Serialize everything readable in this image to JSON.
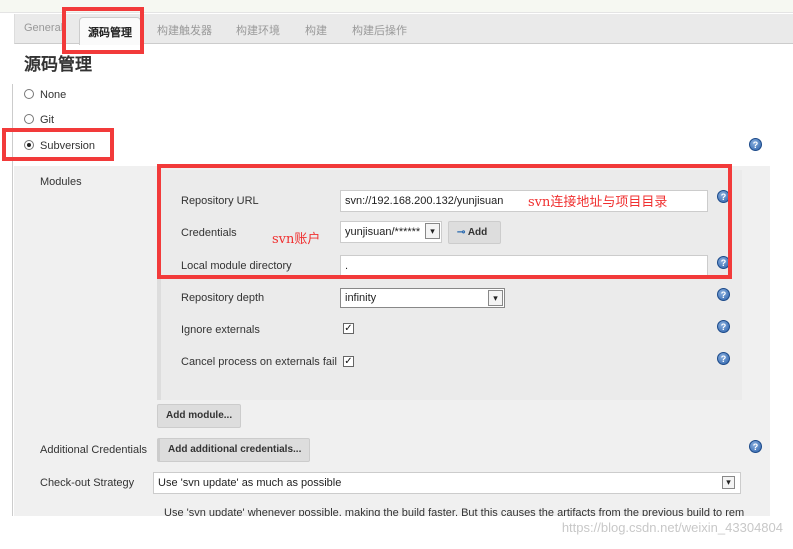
{
  "tabs": [
    {
      "label": "General"
    },
    {
      "label": "源码管理"
    },
    {
      "label": "构建触发器"
    },
    {
      "label": "构建环境"
    },
    {
      "label": "构建"
    },
    {
      "label": "构建后操作"
    }
  ],
  "section_title": "源码管理",
  "scm_options": [
    {
      "label": "None",
      "selected": false
    },
    {
      "label": "Git",
      "selected": false
    },
    {
      "label": "Subversion",
      "selected": true
    }
  ],
  "modules_label": "Modules",
  "repo_url": {
    "label": "Repository URL",
    "value": "svn://192.168.200.132/yunjisuan"
  },
  "credentials": {
    "label": "Credentials",
    "value": "yunjisuan/******",
    "add_label": "Add"
  },
  "local_dir": {
    "label": "Local module directory",
    "value": "."
  },
  "repo_depth": {
    "label": "Repository depth",
    "value": "infinity"
  },
  "ignore_externals": {
    "label": "Ignore externals",
    "checked": true
  },
  "cancel_externals": {
    "label": "Cancel process on externals fail",
    "checked": true
  },
  "add_module_label": "Add module...",
  "additional_credentials": {
    "label": "Additional Credentials",
    "button": "Add additional credentials..."
  },
  "checkout_strategy": {
    "label": "Check-out Strategy",
    "value": "Use 'svn update' as much as possible",
    "description": "Use 'svn update' whenever possible, making the build faster. But this causes the artifacts from the previous build to remain"
  },
  "annotations": {
    "url_note": "svn连接地址与项目目录",
    "account_note": "svn账户"
  },
  "help_glyph": "?",
  "watermark": "https://blog.csdn.net/weixin_43304804",
  "colors": {
    "annotation_red": "#f23a3a",
    "help_blue": "#2a5fa8"
  }
}
